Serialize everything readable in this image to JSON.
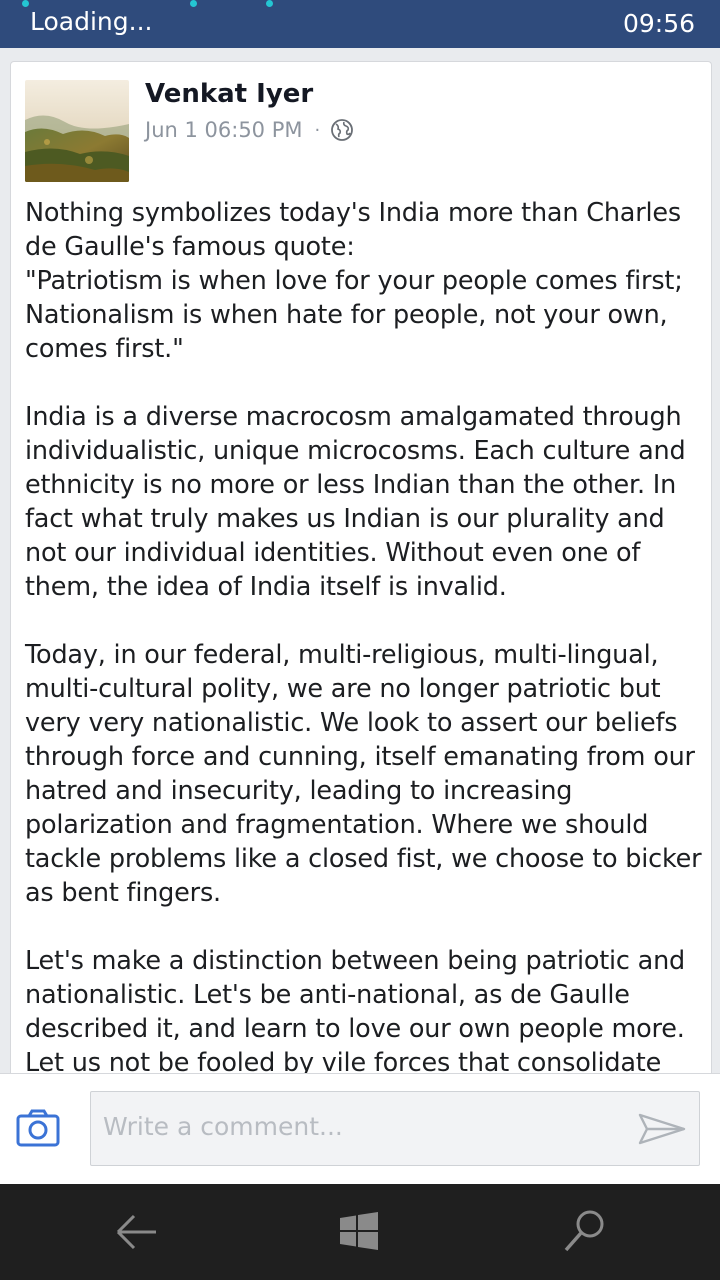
{
  "status_bar": {
    "loading_text": "Loading...",
    "time": "09:56"
  },
  "post": {
    "author": "Venkat Iyer",
    "timestamp": "Jun 1 06:50 PM",
    "separator": "·",
    "privacy_icon": "globe-icon",
    "body": "Nothing symbolizes today's India more than Charles de Gaulle's famous quote:\n\"Patriotism is when love for your people comes first; Nationalism is when hate for people, not your own, comes first.\"\n\nIndia is a diverse macrocosm amalgamated through individualistic, unique microcosms. Each culture and ethnicity is no more or less Indian than the other. In fact what truly makes us Indian is our plurality and not our individual identities. Without even one of them, the idea of India itself is invalid.\n\nToday, in our federal, multi-religious, multi-lingual, multi-cultural polity, we are no longer patriotic but very very nationalistic. We look to assert our beliefs through force and cunning, itself emanating from our hatred and insecurity, leading to increasing polarization and fragmentation. Where we should tackle problems like a closed fist, we choose to bicker as bent fingers.\n\nLet's make a distinction between being patriotic and nationalistic. Let's be anti-national, as de Gaulle described it, and learn to love our own people more. Let us not be fooled by vile forces that consolidate"
  },
  "comment_bar": {
    "placeholder": "Write a comment...",
    "camera_icon": "camera-icon",
    "send_icon": "send-icon"
  },
  "nav_bar": {
    "back_icon": "back-arrow-icon",
    "home_icon": "windows-logo-icon",
    "search_icon": "search-icon"
  },
  "colors": {
    "status_bar_bg": "#2f4b7c",
    "accent_blue": "#3b73d6",
    "nav_bar_bg": "#1f1f1f"
  }
}
